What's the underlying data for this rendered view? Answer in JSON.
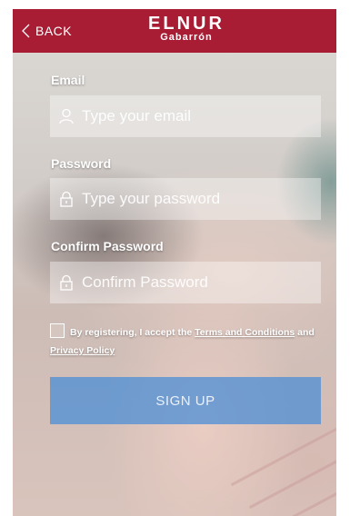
{
  "header": {
    "back_label": "BACK",
    "logo_top": "ELNUR",
    "logo_bottom": "Gabarrón",
    "background_color": "#a81d34"
  },
  "form": {
    "email": {
      "label": "Email",
      "placeholder": "Type your email",
      "value": "",
      "icon": "user-icon"
    },
    "password": {
      "label": "Password",
      "placeholder": "Type your password",
      "value": "",
      "icon": "lock-icon"
    },
    "confirm_password": {
      "label": "Confirm Password",
      "placeholder": "Confirm Password",
      "value": "",
      "icon": "lock-icon"
    }
  },
  "terms": {
    "checked": false,
    "prefix": "By registering, I accept the",
    "terms_link": "Terms and Conditions",
    "conjunction": "and",
    "privacy_link": "Privacy Policy"
  },
  "signup_button": {
    "label": "SIGN UP",
    "color": "#468cd7"
  }
}
